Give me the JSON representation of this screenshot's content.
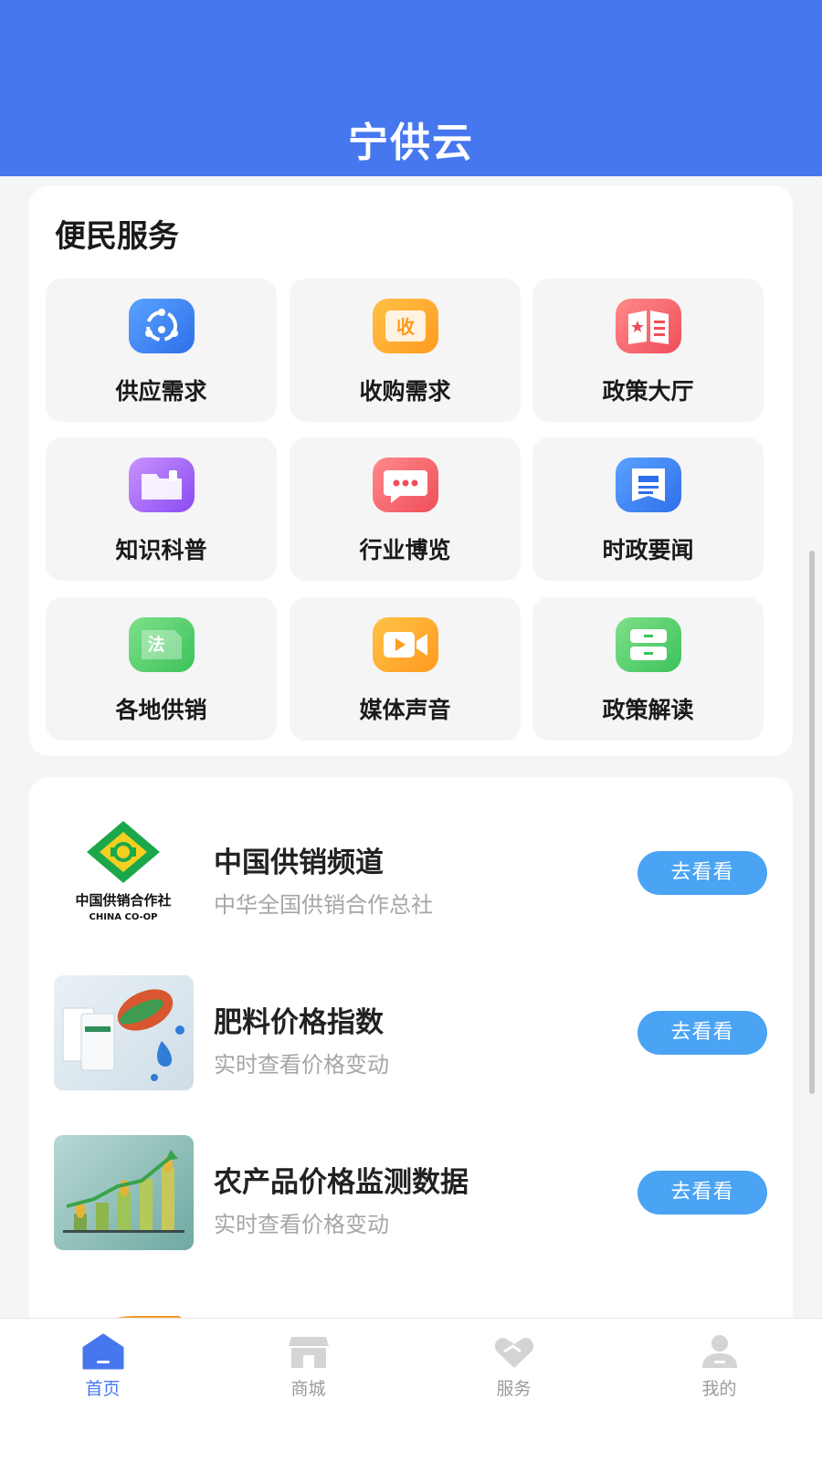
{
  "app": {
    "title": "宁供云"
  },
  "services": {
    "title": "便民服务",
    "items": [
      {
        "label": "供应需求",
        "icon": "supply-icon",
        "color": "#3b82f6"
      },
      {
        "label": "收购需求",
        "icon": "purchase-icon",
        "color": "#ffa726",
        "icon_text": "收"
      },
      {
        "label": "政策大厅",
        "icon": "policy-book-icon",
        "color": "#ef5350"
      },
      {
        "label": "知识科普",
        "icon": "folder-icon",
        "color": "#9c5cf5"
      },
      {
        "label": "行业博览",
        "icon": "chat-bubble-icon",
        "color": "#f25a64"
      },
      {
        "label": "时政要闻",
        "icon": "news-icon",
        "color": "#2f6fe9"
      },
      {
        "label": "各地供销",
        "icon": "law-icon",
        "color": "#47c864",
        "icon_text": "法"
      },
      {
        "label": "媒体声音",
        "icon": "video-camera-icon",
        "color": "#ffa726"
      },
      {
        "label": "政策解读",
        "icon": "cabinet-icon",
        "color": "#47c864"
      }
    ]
  },
  "links": [
    {
      "title": "中国供销频道",
      "subtitle": "中华全国供销合作总社",
      "button": "去看看",
      "logo_text": "中国供销合作社",
      "logo_subtext": "CHINA CO-OP"
    },
    {
      "title": "肥料价格指数",
      "subtitle": "实时查看价格变动",
      "button": "去看看"
    },
    {
      "title": "农产品价格监测数据",
      "subtitle": "实时查看价格变动",
      "button": "去看看"
    }
  ],
  "tabbar": [
    {
      "label": "首页",
      "icon": "home-icon",
      "active": true
    },
    {
      "label": "商城",
      "icon": "store-icon",
      "active": false
    },
    {
      "label": "服务",
      "icon": "handshake-icon",
      "active": false
    },
    {
      "label": "我的",
      "icon": "user-icon",
      "active": false
    }
  ],
  "colors": {
    "primary": "#4677ee",
    "button": "#4aa3f3",
    "tab_active": "#4677ee",
    "tab_inactive": "#9b9b9b"
  }
}
